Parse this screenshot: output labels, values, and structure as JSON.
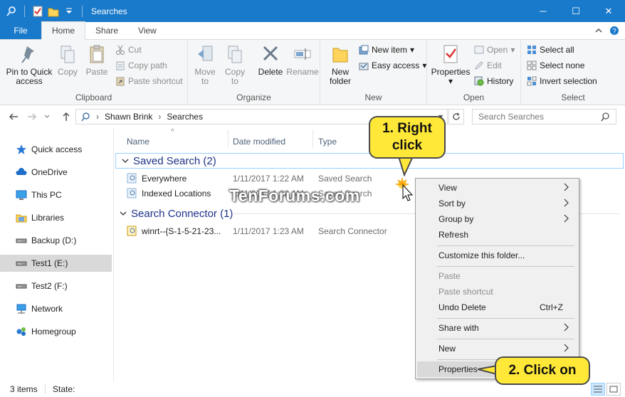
{
  "window": {
    "title": "Searches",
    "minimize": "─",
    "maximize": "☐",
    "close": "✕"
  },
  "tabs": {
    "file": "File",
    "home": "Home",
    "share": "Share",
    "view": "View"
  },
  "ribbon": {
    "clipboard": {
      "label": "Clipboard",
      "pin": [
        "Pin to Quick",
        "access"
      ],
      "copy": "Copy",
      "paste": "Paste",
      "cut": "Cut",
      "copy_path": "Copy path",
      "paste_shortcut": "Paste shortcut"
    },
    "organize": {
      "label": "Organize",
      "move_to": [
        "Move",
        "to"
      ],
      "copy_to": [
        "Copy",
        "to"
      ],
      "delete": "Delete",
      "rename": "Rename"
    },
    "new": {
      "label": "New",
      "new_folder": [
        "New",
        "folder"
      ],
      "new_item": "New item",
      "easy_access": "Easy access"
    },
    "open": {
      "label": "Open",
      "properties": "Properties",
      "open": "Open",
      "edit": "Edit",
      "history": "History"
    },
    "select": {
      "label": "Select",
      "select_all": "Select all",
      "select_none": "Select none",
      "invert": "Invert selection"
    }
  },
  "address": {
    "crumbs": [
      "Shawn Brink",
      "Searches"
    ],
    "search_placeholder": "Search Searches"
  },
  "nav": {
    "items": [
      "Quick access",
      "OneDrive",
      "This PC",
      "Libraries",
      "Backup (D:)",
      "Test1 (E:)",
      "Test2 (F:)",
      "Network",
      "Homegroup"
    ]
  },
  "columns": {
    "name": "Name",
    "date": "Date modified",
    "type": "Type"
  },
  "groups": [
    {
      "title": "Saved Search (2)",
      "rows": [
        {
          "name": "Everywhere",
          "date": "1/11/2017 1:22 AM",
          "type": "Saved Search"
        },
        {
          "name": "Indexed Locations",
          "date": "1/11/2017 1:22 AM",
          "type": "Saved Search"
        }
      ]
    },
    {
      "title": "Search Connector (1)",
      "rows": [
        {
          "name": "winrt--{S-1-5-21-23...",
          "date": "1/11/2017 1:23 AM",
          "type": "Search Connector"
        }
      ]
    }
  ],
  "status": {
    "items": "3 items",
    "state": "State:"
  },
  "context_menu": {
    "view": "View",
    "sort_by": "Sort by",
    "group_by": "Group by",
    "refresh": "Refresh",
    "customize": "Customize this folder...",
    "paste": "Paste",
    "paste_shortcut": "Paste shortcut",
    "undo_delete": "Undo Delete",
    "undo_shortcut": "Ctrl+Z",
    "share_with": "Share with",
    "new": "New",
    "properties": "Properties"
  },
  "callouts": {
    "step1": [
      "1. Right",
      "click"
    ],
    "step2": "2. Click on"
  },
  "watermark": "TenForums.com",
  "colors": {
    "accent": "#1979ca",
    "callout": "#ffe837"
  }
}
